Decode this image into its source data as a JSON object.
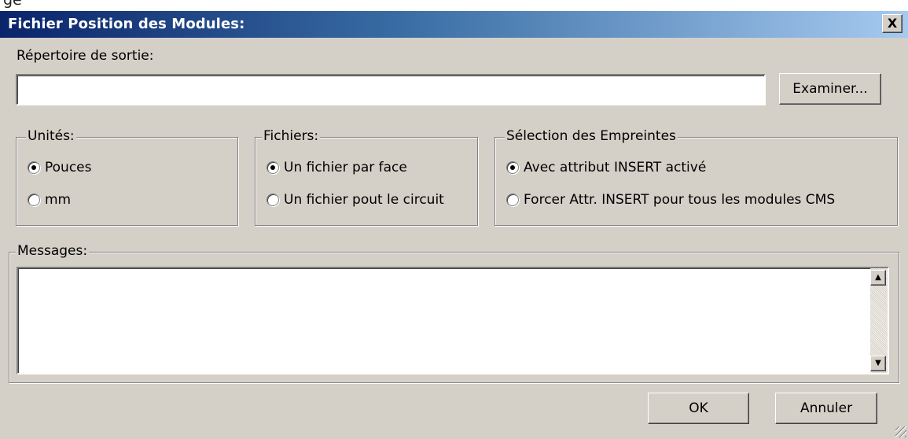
{
  "dialog": {
    "title": "Fichier Position des Modules:",
    "close_label": "X"
  },
  "output": {
    "label": "Répertoire de sortie:",
    "value": "",
    "browse_label": "Examiner..."
  },
  "units": {
    "title": "Unités:",
    "options": [
      {
        "label": "Pouces",
        "checked": true
      },
      {
        "label": "mm",
        "checked": false
      }
    ]
  },
  "files": {
    "title": "Fichiers:",
    "options": [
      {
        "label": "Un fichier par face",
        "checked": true
      },
      {
        "label": "Un fichier pout le circuit",
        "checked": false
      }
    ]
  },
  "footprints": {
    "title": "Sélection des Empreintes",
    "options": [
      {
        "label": "Avec attribut INSERT activé",
        "checked": true
      },
      {
        "label": "Forcer Attr. INSERT pour tous les modules CMS",
        "checked": false
      }
    ]
  },
  "messages": {
    "title": "Messages:",
    "content": ""
  },
  "buttons": {
    "ok_label": "OK",
    "cancel_label": "Annuler"
  },
  "top_strip_text": "ge"
}
